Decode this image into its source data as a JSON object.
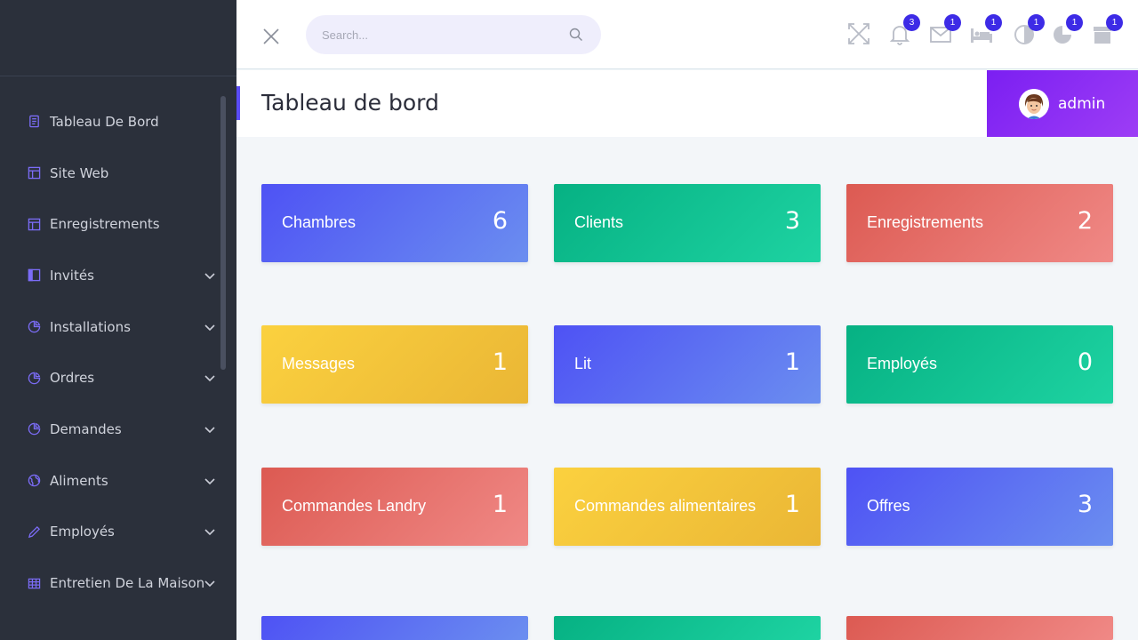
{
  "sidebar": {
    "items": [
      {
        "label": "Tableau De Bord",
        "icon": "document-icon",
        "has_children": false
      },
      {
        "label": "Site Web",
        "icon": "layout-icon",
        "has_children": false
      },
      {
        "label": "Enregistrements",
        "icon": "layout-icon",
        "has_children": false
      },
      {
        "label": "Invités",
        "icon": "columns-icon",
        "has_children": true
      },
      {
        "label": "Installations",
        "icon": "pie-chart-icon",
        "has_children": true
      },
      {
        "label": "Ordres",
        "icon": "pie-chart-icon",
        "has_children": true
      },
      {
        "label": "Demandes",
        "icon": "pie-chart-icon",
        "has_children": true
      },
      {
        "label": "Aliments",
        "icon": "globe-icon",
        "has_children": true
      },
      {
        "label": "Employés",
        "icon": "pencil-icon",
        "has_children": true
      },
      {
        "label": "Entretien De La Maison",
        "icon": "grid-icon",
        "has_children": true
      }
    ]
  },
  "search": {
    "placeholder": "Search...",
    "value": ""
  },
  "notifications": {
    "bell": "3",
    "mail": "1",
    "bed": "1",
    "half_circle": "1",
    "pie": "1",
    "box": "1"
  },
  "header": {
    "title": "Tableau de bord",
    "user": "admin"
  },
  "cards": [
    {
      "label": "Chambres",
      "value": "6",
      "color": "blue"
    },
    {
      "label": "Clients",
      "value": "3",
      "color": "green"
    },
    {
      "label": "Enregistrements",
      "value": "2",
      "color": "red"
    },
    {
      "label": "Messages",
      "value": "1",
      "color": "yellow"
    },
    {
      "label": "Lit",
      "value": "1",
      "color": "blue"
    },
    {
      "label": "Employés",
      "value": "0",
      "color": "green"
    },
    {
      "label": "Commandes Landry",
      "value": "1",
      "color": "red"
    },
    {
      "label": "Commandes alimentaires",
      "value": "1",
      "color": "yellow"
    },
    {
      "label": "Offres",
      "value": "3",
      "color": "blue"
    }
  ],
  "colors": {
    "sidebar_bg": "#2b303b",
    "accent_purple": "#8a2be2",
    "badge": "#3d2be6",
    "card_blue": "#5a63f2",
    "card_green": "#10c093",
    "card_red": "#e6706a",
    "card_yellow": "#f5c83b"
  }
}
